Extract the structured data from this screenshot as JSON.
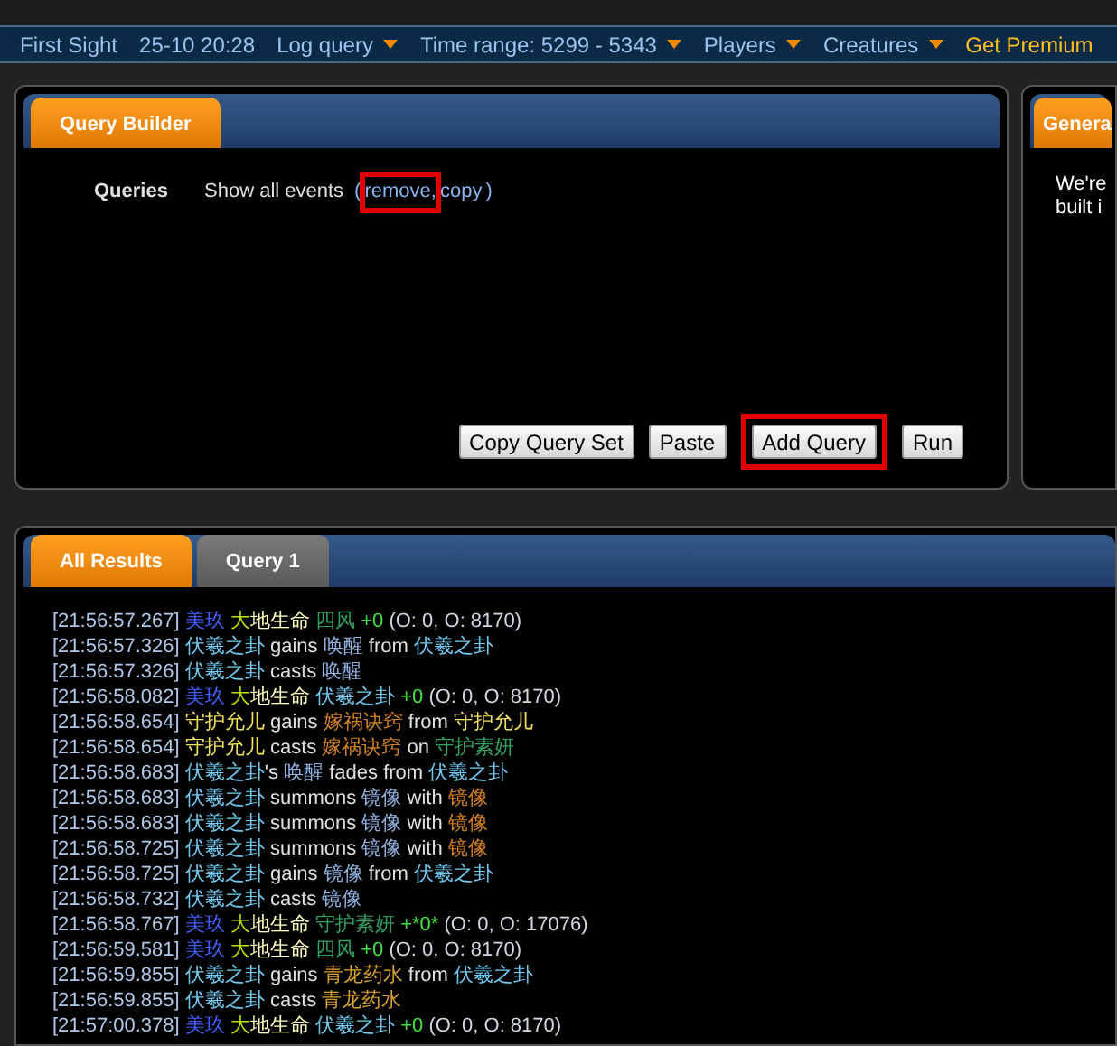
{
  "top_bar": {
    "items": [
      {
        "label": "First Sight",
        "kind": "label"
      },
      {
        "label": "25-10 20:28",
        "kind": "label"
      },
      {
        "label": "Log query",
        "kind": "menu"
      },
      {
        "label": "Time range: 5299 - 5343",
        "kind": "menu"
      },
      {
        "label": "Players",
        "kind": "menu"
      },
      {
        "label": "Creatures",
        "kind": "menu"
      },
      {
        "label": "Get Premium",
        "kind": "premium"
      }
    ]
  },
  "query_builder": {
    "tabs": [
      {
        "label": "Query Builder",
        "selected": true
      }
    ],
    "label": "Queries",
    "query": "Show all events",
    "open_paren": "(",
    "close_paren": ")",
    "links": [
      {
        "label": "remove,",
        "highlighted": true
      },
      {
        "label": "copy",
        "highlighted": false
      }
    ],
    "buttons": [
      {
        "label": "Copy Query Set",
        "highlighted": false
      },
      {
        "label": "Paste",
        "highlighted": false
      },
      {
        "label": "Add Query",
        "highlighted": true
      },
      {
        "label": "Run",
        "highlighted": false
      }
    ]
  },
  "side_panel": {
    "tabs": [
      {
        "label": "Genera",
        "selected": true
      }
    ],
    "lines": [
      "We're",
      "built i"
    ]
  },
  "results": {
    "tabs": [
      {
        "label": "All Results",
        "selected": true
      },
      {
        "label": "Query 1",
        "selected": false
      }
    ],
    "lines": [
      {
        "segments": [
          {
            "text": "[21:56:57.267]",
            "color": "#b0c8e8"
          },
          {
            "text": " 美玖",
            "color": "#4060ff"
          },
          {
            "text": " 大",
            "color": "#b8e000"
          },
          {
            "text": "地生命",
            "color": "#ffffc0"
          },
          {
            "text": " 四风",
            "color": "#30a060"
          },
          {
            "text": " +0",
            "color": "#40e040"
          },
          {
            "text": " (O: 0, O: 8170)",
            "color": "#d0d8e0"
          }
        ]
      },
      {
        "segments": [
          {
            "text": "[21:56:57.326]",
            "color": "#b0c8e8"
          },
          {
            "text": " 伏羲之卦",
            "color": "#70c8f0"
          },
          {
            "text": " gains ",
            "color": "#e0e0e0"
          },
          {
            "text": "唤醒",
            "color": "#90b0e0"
          },
          {
            "text": " from ",
            "color": "#e0e0e0"
          },
          {
            "text": "伏羲之卦",
            "color": "#70c8f0"
          }
        ]
      },
      {
        "segments": [
          {
            "text": "[21:56:57.326]",
            "color": "#b0c8e8"
          },
          {
            "text": " 伏羲之卦",
            "color": "#70c8f0"
          },
          {
            "text": " casts ",
            "color": "#e0e0e0"
          },
          {
            "text": "唤醒",
            "color": "#90b0e0"
          }
        ]
      },
      {
        "segments": [
          {
            "text": "[21:56:58.082]",
            "color": "#b0c8e8"
          },
          {
            "text": " 美玖",
            "color": "#4060ff"
          },
          {
            "text": " 大",
            "color": "#b8e000"
          },
          {
            "text": "地生命",
            "color": "#ffffc0"
          },
          {
            "text": " 伏羲之卦",
            "color": "#70c8f0"
          },
          {
            "text": " +0",
            "color": "#40e040"
          },
          {
            "text": " (O: 0, O: 8170)",
            "color": "#d0d8e0"
          }
        ]
      },
      {
        "segments": [
          {
            "text": "[21:56:58.654]",
            "color": "#b0c8e8"
          },
          {
            "text": " 守护允儿",
            "color": "#f0e060"
          },
          {
            "text": " gains ",
            "color": "#e0e0e0"
          },
          {
            "text": "嫁祸诀窍",
            "color": "#d08020"
          },
          {
            "text": " from ",
            "color": "#e0e0e0"
          },
          {
            "text": "守护允儿",
            "color": "#f0e060"
          }
        ]
      },
      {
        "segments": [
          {
            "text": "[21:56:58.654]",
            "color": "#b0c8e8"
          },
          {
            "text": " 守护允儿",
            "color": "#f0e060"
          },
          {
            "text": " casts ",
            "color": "#e0e0e0"
          },
          {
            "text": "嫁祸诀窍",
            "color": "#d08020"
          },
          {
            "text": " on ",
            "color": "#e0e0e0"
          },
          {
            "text": "守护素妍",
            "color": "#30a060"
          }
        ]
      },
      {
        "segments": [
          {
            "text": "[21:56:58.683]",
            "color": "#b0c8e8"
          },
          {
            "text": " 伏羲之卦",
            "color": "#70c8f0"
          },
          {
            "text": "'s ",
            "color": "#e0e0e0"
          },
          {
            "text": "唤醒",
            "color": "#90b0e0"
          },
          {
            "text": " fades from ",
            "color": "#e0e0e0"
          },
          {
            "text": "伏羲之卦",
            "color": "#70c8f0"
          }
        ]
      },
      {
        "segments": [
          {
            "text": "[21:56:58.683]",
            "color": "#b0c8e8"
          },
          {
            "text": " 伏羲之卦",
            "color": "#70c8f0"
          },
          {
            "text": " summons ",
            "color": "#e0e0e0"
          },
          {
            "text": "镜像",
            "color": "#90b0e0"
          },
          {
            "text": " with ",
            "color": "#e0e0e0"
          },
          {
            "text": "镜像",
            "color": "#d08020"
          }
        ]
      },
      {
        "segments": [
          {
            "text": "[21:56:58.683]",
            "color": "#b0c8e8"
          },
          {
            "text": " 伏羲之卦",
            "color": "#70c8f0"
          },
          {
            "text": " summons ",
            "color": "#e0e0e0"
          },
          {
            "text": "镜像",
            "color": "#90b0e0"
          },
          {
            "text": " with ",
            "color": "#e0e0e0"
          },
          {
            "text": "镜像",
            "color": "#d08020"
          }
        ]
      },
      {
        "segments": [
          {
            "text": "[21:56:58.725]",
            "color": "#b0c8e8"
          },
          {
            "text": " 伏羲之卦",
            "color": "#70c8f0"
          },
          {
            "text": " summons ",
            "color": "#e0e0e0"
          },
          {
            "text": "镜像",
            "color": "#90b0e0"
          },
          {
            "text": " with ",
            "color": "#e0e0e0"
          },
          {
            "text": "镜像",
            "color": "#d08020"
          }
        ]
      },
      {
        "segments": [
          {
            "text": "[21:56:58.725]",
            "color": "#b0c8e8"
          },
          {
            "text": " 伏羲之卦",
            "color": "#70c8f0"
          },
          {
            "text": " gains ",
            "color": "#e0e0e0"
          },
          {
            "text": "镜像",
            "color": "#90b0e0"
          },
          {
            "text": " from ",
            "color": "#e0e0e0"
          },
          {
            "text": "伏羲之卦",
            "color": "#70c8f0"
          }
        ]
      },
      {
        "segments": [
          {
            "text": "[21:56:58.732]",
            "color": "#b0c8e8"
          },
          {
            "text": " 伏羲之卦",
            "color": "#70c8f0"
          },
          {
            "text": " casts ",
            "color": "#e0e0e0"
          },
          {
            "text": "镜像",
            "color": "#90b0e0"
          }
        ]
      },
      {
        "segments": [
          {
            "text": "[21:56:58.767]",
            "color": "#b0c8e8"
          },
          {
            "text": " 美玖",
            "color": "#4060ff"
          },
          {
            "text": " 大",
            "color": "#b8e000"
          },
          {
            "text": "地生命",
            "color": "#ffffc0"
          },
          {
            "text": " 守护素妍",
            "color": "#30a060"
          },
          {
            "text": " +*0*",
            "color": "#40e040"
          },
          {
            "text": " (O: 0, O: 17076)",
            "color": "#d0d8e0"
          }
        ]
      },
      {
        "segments": [
          {
            "text": "[21:56:59.581]",
            "color": "#b0c8e8"
          },
          {
            "text": " 美玖",
            "color": "#4060ff"
          },
          {
            "text": " 大",
            "color": "#b8e000"
          },
          {
            "text": "地生命",
            "color": "#ffffc0"
          },
          {
            "text": " 四风",
            "color": "#30a060"
          },
          {
            "text": " +0",
            "color": "#40e040"
          },
          {
            "text": " (O: 0, O: 8170)",
            "color": "#d0d8e0"
          }
        ]
      },
      {
        "segments": [
          {
            "text": "[21:56:59.855]",
            "color": "#b0c8e8"
          },
          {
            "text": " 伏羲之卦",
            "color": "#70c8f0"
          },
          {
            "text": " gains ",
            "color": "#e0e0e0"
          },
          {
            "text": "青龙药水",
            "color": "#d8a030"
          },
          {
            "text": " from ",
            "color": "#e0e0e0"
          },
          {
            "text": "伏羲之卦",
            "color": "#70c8f0"
          }
        ]
      },
      {
        "segments": [
          {
            "text": "[21:56:59.855]",
            "color": "#b0c8e8"
          },
          {
            "text": " 伏羲之卦",
            "color": "#70c8f0"
          },
          {
            "text": " casts ",
            "color": "#e0e0e0"
          },
          {
            "text": "青龙药水",
            "color": "#d8a030"
          }
        ]
      },
      {
        "segments": [
          {
            "text": "[21:57:00.378]",
            "color": "#b0c8e8"
          },
          {
            "text": " 美玖",
            "color": "#4060ff"
          },
          {
            "text": " 大",
            "color": "#b8e000"
          },
          {
            "text": "地生命",
            "color": "#ffffc0"
          },
          {
            "text": " 伏羲之卦",
            "color": "#70c8f0"
          },
          {
            "text": " +0",
            "color": "#40e040"
          },
          {
            "text": " (O: 0, O: 8170)",
            "color": "#d0d8e0"
          }
        ]
      }
    ]
  }
}
